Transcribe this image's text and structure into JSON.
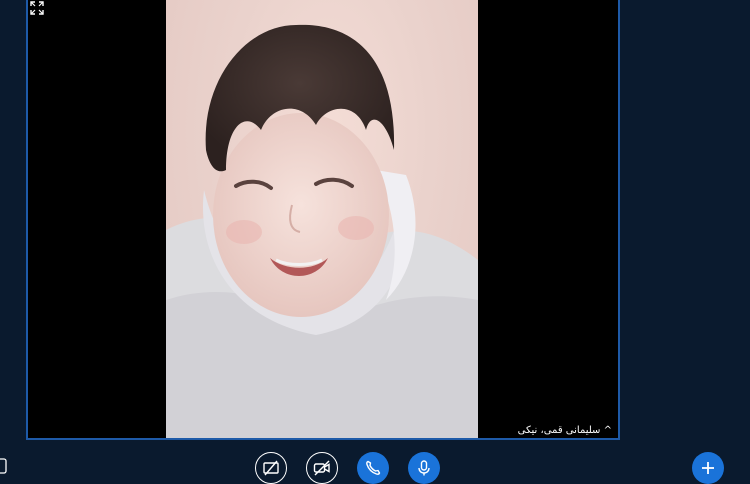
{
  "call": {
    "participant_name": "^ سلیمانی قمی، نیکی"
  },
  "colors": {
    "background": "#0a1a2e",
    "window_border": "#1e5aa8",
    "accent_button": "#1a73d9"
  },
  "icons": {
    "fullscreen": "expand-icon",
    "share_screen_off": "screen-share-off-icon",
    "video_off": "video-off-icon",
    "call": "phone-icon",
    "mic": "microphone-icon",
    "add": "plus-icon"
  }
}
